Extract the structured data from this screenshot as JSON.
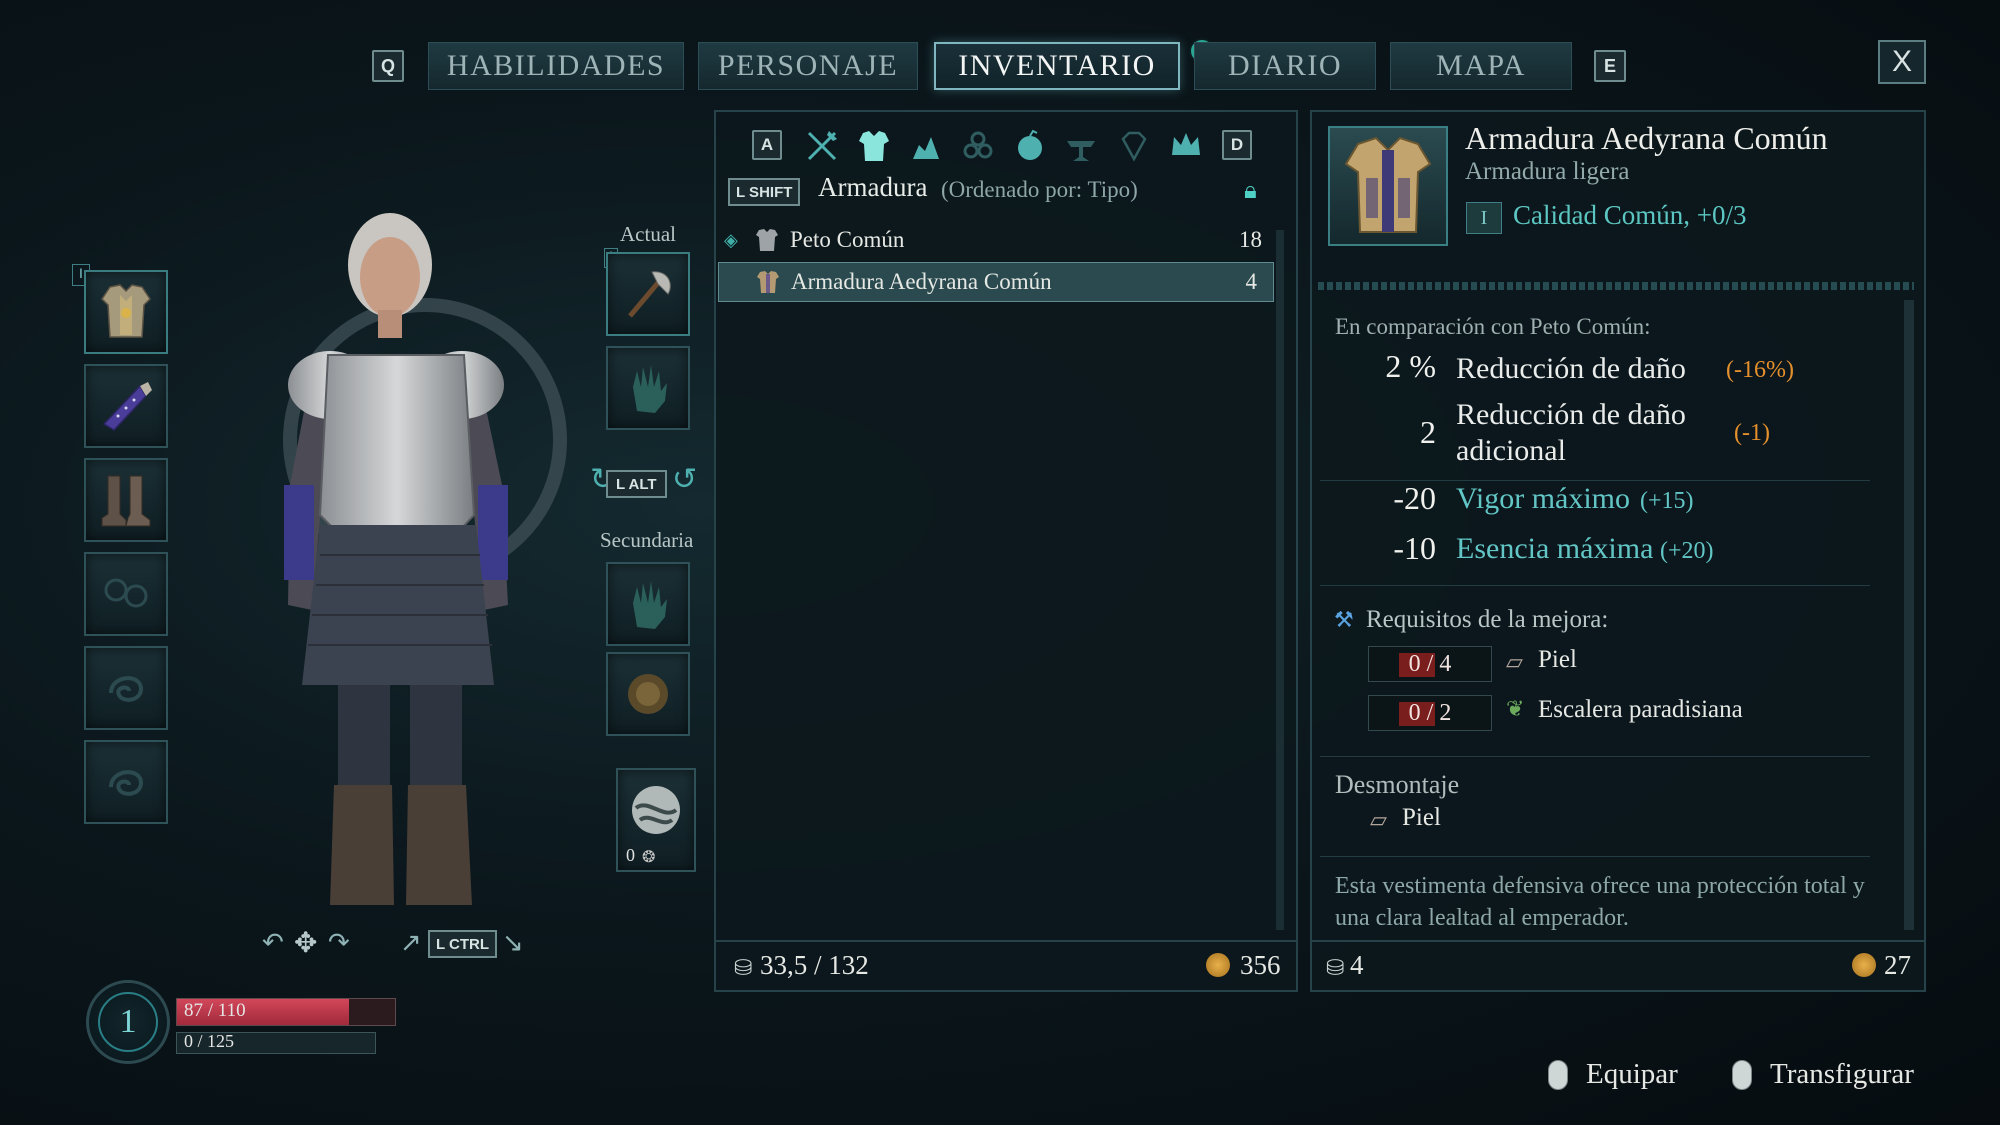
{
  "tabs": {
    "left_key": "Q",
    "right_key": "E",
    "items": [
      {
        "label": "HABILIDADES"
      },
      {
        "label": "PERSONAJE"
      },
      {
        "label": "INVENTARIO"
      },
      {
        "label": "DIARIO"
      },
      {
        "label": "MAPA"
      }
    ],
    "active": "INVENTARIO",
    "alert": "!",
    "close": "X"
  },
  "equipment": {
    "current_label": "Actual",
    "secondary_label": "Secundaria",
    "swap_key": "L ALT",
    "rotate_key": "L CTRL",
    "consumable_count": "0"
  },
  "player": {
    "level": "1",
    "health": "87 / 110",
    "health_fraction": 0.79,
    "stamina": "0 / 125",
    "stamina_fraction": 0
  },
  "inventory": {
    "filter_left_key": "A",
    "filter_right_key": "D",
    "sort_key": "L SHIFT",
    "category": "Armadura",
    "sort_text": "(Ordenado por: Tipo)",
    "items": [
      {
        "name": "Peto Común",
        "value": "18"
      },
      {
        "name": "Armadura Aedyrana Común",
        "value": "4"
      }
    ],
    "weight": "33,5 / 132",
    "gold": "356"
  },
  "details": {
    "name": "Armadura Aedyrana Común",
    "type": "Armadura ligera",
    "tier": "I",
    "quality": "Calidad Común, +0/3",
    "comparison_title": "En comparación con Peto Común:",
    "stats": [
      {
        "value": "2 %",
        "name": "Reducción de daño",
        "delta": "(-16%)"
      },
      {
        "value": "2",
        "name_line1": "Reducción de daño",
        "name_line2": "adicional",
        "delta": "(-1)"
      },
      {
        "value": "-20",
        "name": "Vigor máximo",
        "delta": "(+15)"
      },
      {
        "value": "-10",
        "name": "Esencia máxima",
        "delta": "(+20)"
      }
    ],
    "upgrade_title": "Requisitos de la mejora:",
    "requirements": [
      {
        "count": "0 / 4",
        "material": "Piel"
      },
      {
        "count": "0 / 2",
        "material": "Escalera paradisiana"
      }
    ],
    "dismantle_title": "Desmontaje",
    "dismantle_material": "Piel",
    "description": "Esta vestimenta defensiva ofrece una protección total y una clara lealtad al emperador.",
    "weight": "4",
    "value": "27"
  },
  "actions": {
    "equip": "Equipar",
    "transmog": "Transfigurar"
  }
}
